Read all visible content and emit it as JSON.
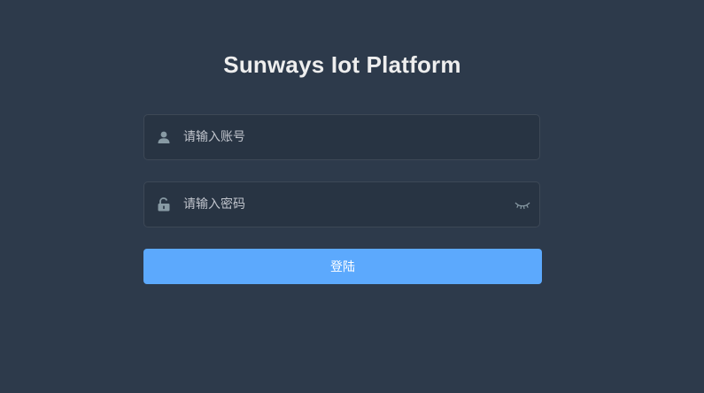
{
  "login": {
    "title": "Sunways Iot Platform",
    "username": {
      "value": "",
      "placeholder": "请输入账号",
      "icon": "user-icon"
    },
    "password": {
      "value": "",
      "placeholder": "请输入密码",
      "icon": "lock-icon",
      "toggle_icon": "eye-closed-icon"
    },
    "submit_label": "登陆"
  },
  "colors": {
    "background": "#2d3a4b",
    "field_background": "#283443",
    "button": "#5ca9fd",
    "title": "#eeeeee",
    "icon": "#889aa4"
  }
}
